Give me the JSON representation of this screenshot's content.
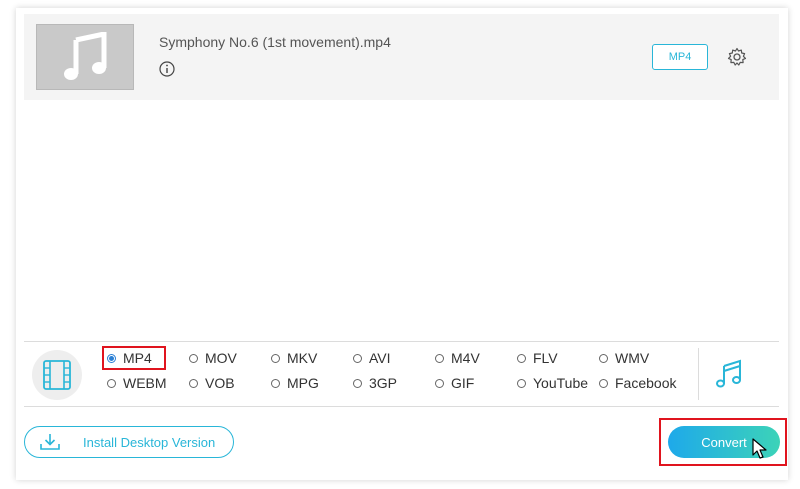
{
  "file": {
    "name": "Symphony No.6 (1st movement).mp4",
    "format_badge": "MP4"
  },
  "formats": {
    "selected": "MP4",
    "row1": [
      "MP4",
      "MOV",
      "MKV",
      "AVI",
      "M4V",
      "FLV",
      "WMV"
    ],
    "row2": [
      "WEBM",
      "VOB",
      "MPG",
      "3GP",
      "GIF",
      "YouTube",
      "Facebook"
    ]
  },
  "actions": {
    "install_label": "Install Desktop Version",
    "convert_label": "Convert"
  },
  "colors": {
    "accent": "#29b6d8",
    "highlight": "#e0141e",
    "convert_gradient_start": "#1ea9ea",
    "convert_gradient_end": "#3cd3b8"
  },
  "icons": {
    "thumbnail": "music-note-icon",
    "info": "info-icon",
    "settings": "gear-icon",
    "video_formats": "film-icon",
    "audio_formats": "music-note-icon",
    "install": "download-icon",
    "cursor": "mouse-cursor-icon"
  }
}
